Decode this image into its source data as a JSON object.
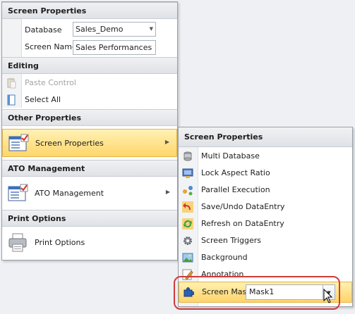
{
  "main_menu": {
    "sections": {
      "screen_properties": "Screen Properties",
      "editing": "Editing",
      "other_properties": "Other Properties",
      "ato_management": "ATO Management",
      "print_options": "Print Options"
    },
    "database": {
      "label": "Database",
      "value": "Sales_Demo"
    },
    "screen_name": {
      "label": "Screen Name",
      "value": "Sales Performances"
    },
    "paste_control": "Paste Control",
    "select_all": "Select All",
    "screen_properties_item": "Screen Properties",
    "ato_management_item": "ATO Management",
    "print_options_item": "Print Options"
  },
  "submenu": {
    "title": "Screen Properties",
    "items": [
      {
        "label": "Multi Database",
        "icon": "multi-database-icon"
      },
      {
        "label": "Lock Aspect Ratio",
        "icon": "lock-aspect-icon"
      },
      {
        "label": "Parallel Execution",
        "icon": "parallel-icon"
      },
      {
        "label": "Save/Undo DataEntry",
        "icon": "undo-icon"
      },
      {
        "label": "Refresh on DataEntry",
        "icon": "refresh-icon"
      },
      {
        "label": "Screen Triggers",
        "icon": "gear-icon"
      },
      {
        "label": "Background",
        "icon": "picture-icon"
      },
      {
        "label": "Annotation",
        "icon": "pencil-icon"
      }
    ],
    "screen_mask": {
      "label": "Screen Mask",
      "value": "Mask1"
    }
  }
}
